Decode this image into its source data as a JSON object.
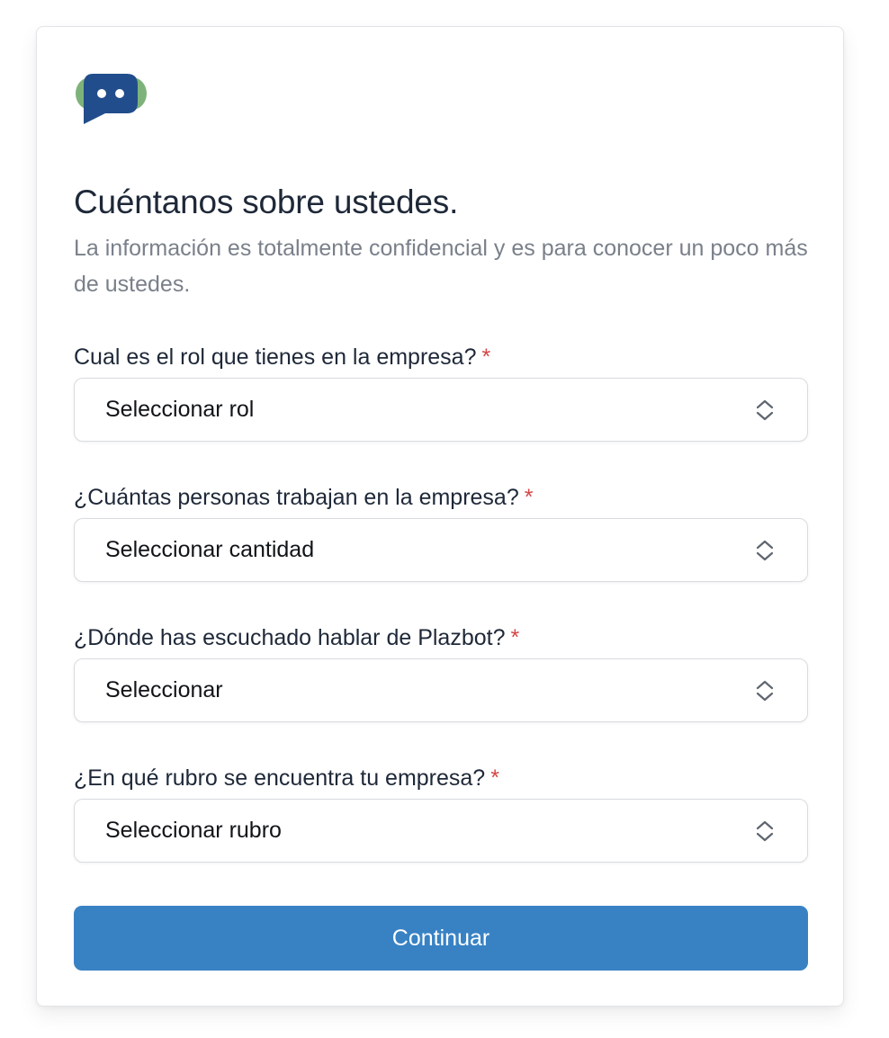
{
  "brand": {
    "logo_icon": "chat-bubble-bot-icon",
    "colors": {
      "primary": "#214d8c",
      "secondary": "#7db37a"
    }
  },
  "header": {
    "title": "Cuéntanos sobre ustedes.",
    "subtitle": "La información es totalmente confidencial y es para conocer un poco más de ustedes."
  },
  "form": {
    "required_mark": "*",
    "fields": [
      {
        "label": "Cual es el rol que tienes en la empresa?",
        "value": "Seleccionar rol"
      },
      {
        "label": "¿Cuántas personas trabajan en la empresa?",
        "value": "Seleccionar cantidad"
      },
      {
        "label": "¿Dónde has escuchado hablar de Plazbot?",
        "value": "Seleccionar"
      },
      {
        "label": "¿En qué rubro se encuentra tu empresa?",
        "value": "Seleccionar rubro"
      }
    ],
    "submit_label": "Continuar",
    "accent_color": "#3882c4"
  }
}
